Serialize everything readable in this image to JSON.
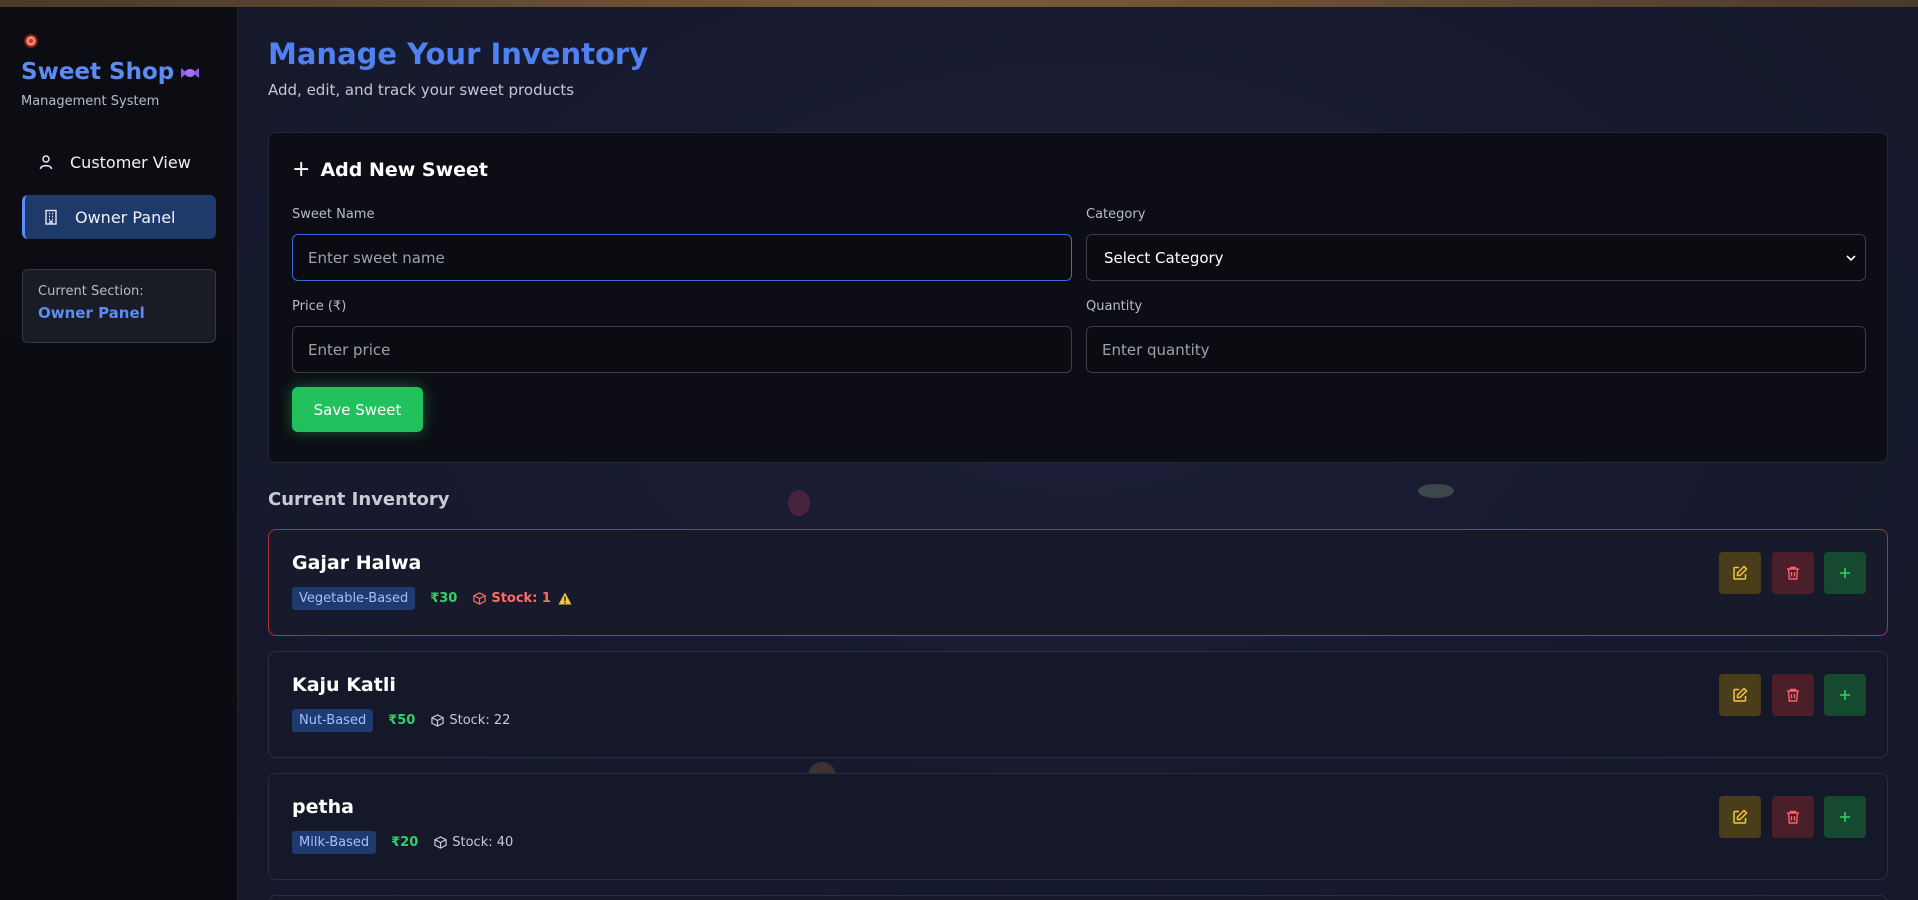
{
  "brand": {
    "title": "Sweet Shop",
    "subtitle": "Management System"
  },
  "sidebar": {
    "items": [
      {
        "label": "Customer View",
        "icon": "user-icon",
        "active": false
      },
      {
        "label": "Owner Panel",
        "icon": "building-icon",
        "active": true
      }
    ],
    "section": {
      "label": "Current Section:",
      "value": "Owner Panel"
    }
  },
  "header": {
    "title": "Manage Your Inventory",
    "subtitle": "Add, edit, and track your sweet products"
  },
  "form": {
    "title": "Add New Sweet",
    "name": {
      "label": "Sweet Name",
      "placeholder": "Enter sweet name",
      "value": ""
    },
    "category": {
      "label": "Category",
      "value": "Select Category"
    },
    "price": {
      "label": "Price (₹)",
      "placeholder": "Enter price",
      "value": ""
    },
    "quantity": {
      "label": "Quantity",
      "placeholder": "Enter quantity",
      "value": ""
    },
    "save_label": "Save Sweet"
  },
  "inventory": {
    "title": "Current Inventory",
    "items": [
      {
        "name": "Gajar Halwa",
        "category": "Vegetable-Based",
        "price": "₹30",
        "stock": "Stock: 1",
        "low": true
      },
      {
        "name": "Kaju Katli",
        "category": "Nut-Based",
        "price": "₹50",
        "stock": "Stock: 22",
        "low": false
      },
      {
        "name": "petha",
        "category": "Milk-Based",
        "price": "₹20",
        "stock": "Stock: 40",
        "low": false
      }
    ]
  },
  "colors": {
    "accent": "#4f82f0",
    "success": "#21c25e",
    "danger": "#b4303a",
    "warning": "#f5c542"
  }
}
